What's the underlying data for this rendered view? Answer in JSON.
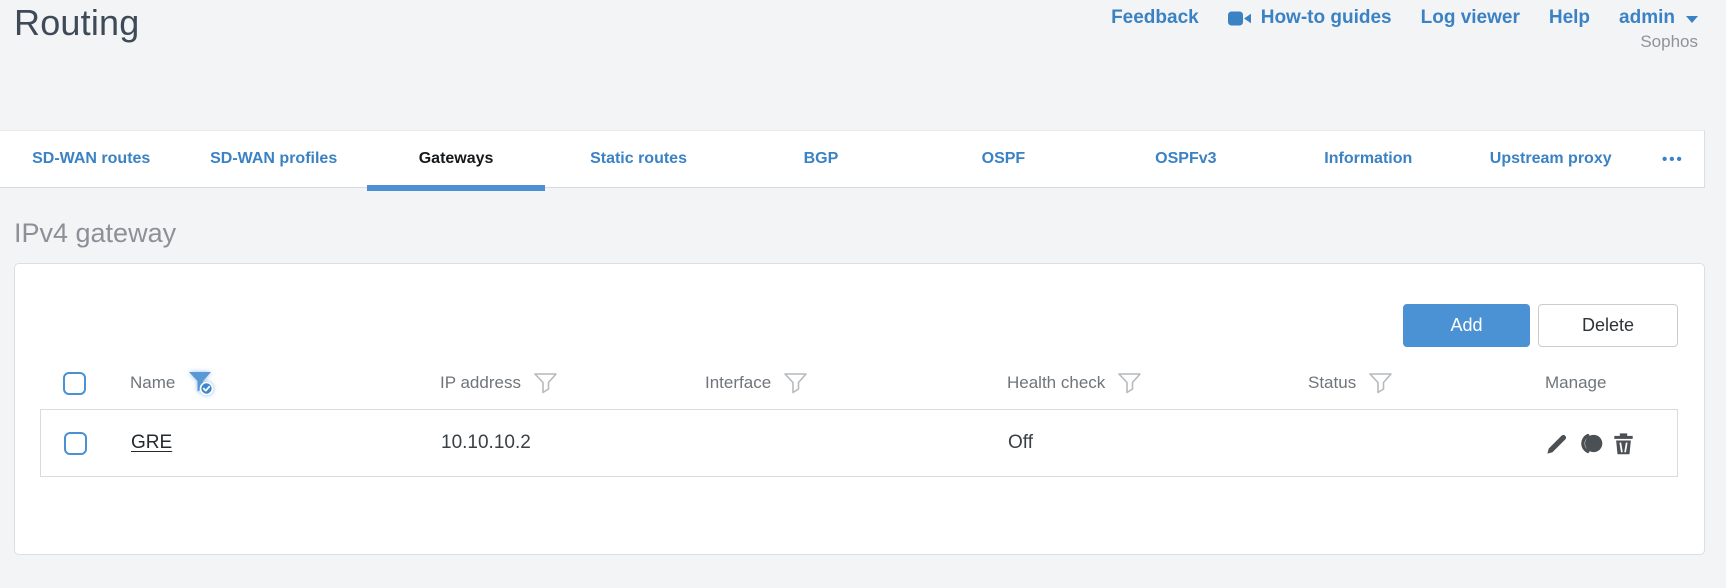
{
  "page": {
    "title": "Routing",
    "brand": "Sophos"
  },
  "header_links": {
    "feedback": "Feedback",
    "how_to_guides": "How-to guides",
    "log_viewer": "Log viewer",
    "help": "Help",
    "user_menu": "admin"
  },
  "tabs": {
    "items": [
      "SD-WAN routes",
      "SD-WAN profiles",
      "Gateways",
      "Static routes",
      "BGP",
      "OSPF",
      "OSPFv3",
      "Information",
      "Upstream proxy"
    ],
    "active": "Gateways",
    "overflow_label": "•••"
  },
  "section": {
    "heading": "IPv4 gateway"
  },
  "toolbar": {
    "add_label": "Add",
    "delete_label": "Delete"
  },
  "table": {
    "columns": [
      {
        "label": "Name",
        "filter": "filter-applied"
      },
      {
        "label": "IP address",
        "filter": "filter"
      },
      {
        "label": "Interface",
        "filter": "filter"
      },
      {
        "label": "Health check",
        "filter": "filter"
      },
      {
        "label": "Status",
        "filter": "filter"
      },
      {
        "label": "Manage",
        "filter": "none"
      }
    ],
    "rows": [
      {
        "name": "GRE",
        "ip_address": "10.10.10.2",
        "interface": "",
        "health_check": "Off",
        "status": "green",
        "actions": [
          "edit",
          "clone",
          "delete"
        ]
      }
    ]
  },
  "colors": {
    "accent_blue": "#4a90d2",
    "link_blue": "#3a82c4",
    "status_green": "#7dc242"
  }
}
